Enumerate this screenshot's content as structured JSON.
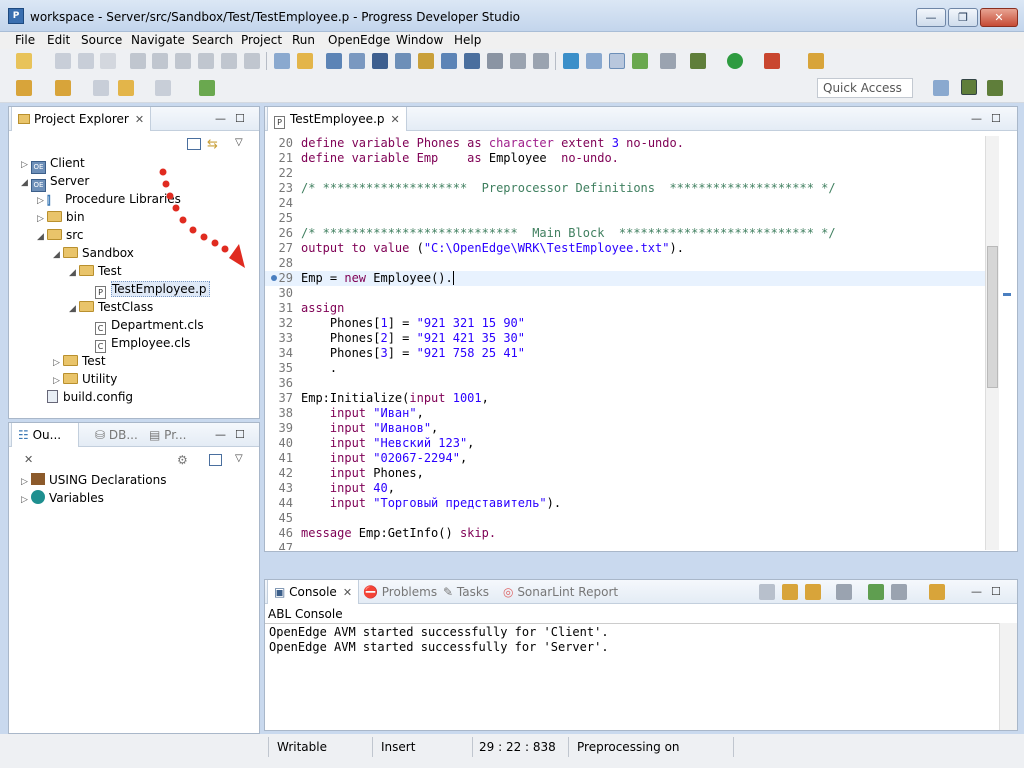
{
  "window": {
    "title": "workspace - Server/src/Sandbox/Test/TestEmployee.p - Progress Developer Studio",
    "min": "—",
    "max": "❐",
    "close": "✕"
  },
  "menu": [
    "File",
    "Edit",
    "Source",
    "Navigate",
    "Search",
    "Project",
    "Run",
    "OpenEdge",
    "Window",
    "Help"
  ],
  "quick_access": "Quick Access",
  "project_explorer": {
    "tab_label": "Project Explorer",
    "items": [
      {
        "label": "Client",
        "type": "project",
        "twisty": "▷"
      },
      {
        "label": "Server",
        "type": "project",
        "twisty": "◢"
      },
      {
        "label": "Procedure Libraries",
        "type": "lib",
        "twisty": "▷"
      },
      {
        "label": "bin",
        "type": "folder",
        "twisty": "▷"
      },
      {
        "label": "src",
        "type": "folder",
        "twisty": "◢"
      },
      {
        "label": "Sandbox",
        "type": "folder",
        "twisty": "◢"
      },
      {
        "label": "Test",
        "type": "folder",
        "twisty": "◢"
      },
      {
        "label": "TestEmployee.p",
        "type": "file-p",
        "twisty": ""
      },
      {
        "label": "TestClass",
        "type": "folder",
        "twisty": "◢"
      },
      {
        "label": "Department.cls",
        "type": "file-c",
        "twisty": ""
      },
      {
        "label": "Employee.cls",
        "type": "file-c",
        "twisty": ""
      },
      {
        "label": "Test",
        "type": "folder",
        "twisty": "▷"
      },
      {
        "label": "Utility",
        "type": "folder",
        "twisty": "▷"
      },
      {
        "label": "build.config",
        "type": "config",
        "twisty": ""
      }
    ]
  },
  "outline": {
    "tabs": [
      "Ou...",
      "DB...",
      "Pr..."
    ],
    "items": [
      {
        "label": "USING Declarations"
      },
      {
        "label": "Variables"
      }
    ]
  },
  "editor": {
    "tab_label": "TestEmployee.p",
    "lines": [
      {
        "n": "20",
        "code": [
          {
            "t": "define variable Phones ",
            "c": "kw"
          },
          {
            "t": "as ",
            "c": "kw"
          },
          {
            "t": "character ",
            "c": "kwb"
          },
          {
            "t": "extent ",
            "c": "kw"
          },
          {
            "t": "3 ",
            "c": "num"
          },
          {
            "t": "no-undo.",
            "c": "kw"
          }
        ]
      },
      {
        "n": "21",
        "code": [
          {
            "t": "define variable Emp    ",
            "c": "kw"
          },
          {
            "t": "as ",
            "c": "kw"
          },
          {
            "t": "Employee  ",
            "c": ""
          },
          {
            "t": "no-undo.",
            "c": "kw"
          }
        ]
      },
      {
        "n": "22",
        "code": []
      },
      {
        "n": "23",
        "code": [
          {
            "t": "/* ********************  Preprocessor Definitions  ******************** */",
            "c": "cmt"
          }
        ]
      },
      {
        "n": "24",
        "code": []
      },
      {
        "n": "25",
        "code": []
      },
      {
        "n": "26",
        "code": [
          {
            "t": "/* ***************************  Main Block  *************************** */",
            "c": "cmt"
          }
        ]
      },
      {
        "n": "27",
        "code": [
          {
            "t": "output to value ",
            "c": "kw"
          },
          {
            "t": "(",
            "c": ""
          },
          {
            "t": "\"C:\\OpenEdge\\WRK\\TestEmployee.txt\"",
            "c": "str"
          },
          {
            "t": ").",
            "c": ""
          }
        ]
      },
      {
        "n": "28",
        "code": []
      },
      {
        "n": "29",
        "code": [
          {
            "t": "Emp = ",
            "c": ""
          },
          {
            "t": "new ",
            "c": "kw"
          },
          {
            "t": "Employee().",
            "c": ""
          }
        ],
        "current": true
      },
      {
        "n": "30",
        "code": []
      },
      {
        "n": "31",
        "code": [
          {
            "t": "assign",
            "c": "kw"
          }
        ]
      },
      {
        "n": "32",
        "code": [
          {
            "t": "    Phones[",
            "c": ""
          },
          {
            "t": "1",
            "c": "num"
          },
          {
            "t": "] = ",
            "c": ""
          },
          {
            "t": "\"921 321 15 90\"",
            "c": "str"
          }
        ]
      },
      {
        "n": "33",
        "code": [
          {
            "t": "    Phones[",
            "c": ""
          },
          {
            "t": "2",
            "c": "num"
          },
          {
            "t": "] = ",
            "c": ""
          },
          {
            "t": "\"921 421 35 30\"",
            "c": "str"
          }
        ]
      },
      {
        "n": "34",
        "code": [
          {
            "t": "    Phones[",
            "c": ""
          },
          {
            "t": "3",
            "c": "num"
          },
          {
            "t": "] = ",
            "c": ""
          },
          {
            "t": "\"921 758 25 41\"",
            "c": "str"
          }
        ]
      },
      {
        "n": "35",
        "code": [
          {
            "t": "    .",
            "c": ""
          }
        ]
      },
      {
        "n": "36",
        "code": []
      },
      {
        "n": "37",
        "code": [
          {
            "t": "Emp:Initialize(",
            "c": ""
          },
          {
            "t": "input ",
            "c": "kw"
          },
          {
            "t": "1001",
            "c": "num"
          },
          {
            "t": ",",
            "c": ""
          }
        ]
      },
      {
        "n": "38",
        "code": [
          {
            "t": "    input ",
            "c": "kw"
          },
          {
            "t": "\"Иван\"",
            "c": "str"
          },
          {
            "t": ",",
            "c": ""
          }
        ]
      },
      {
        "n": "39",
        "code": [
          {
            "t": "    input ",
            "c": "kw"
          },
          {
            "t": "\"Иванов\"",
            "c": "str"
          },
          {
            "t": ",",
            "c": ""
          }
        ]
      },
      {
        "n": "40",
        "code": [
          {
            "t": "    input ",
            "c": "kw"
          },
          {
            "t": "\"Невский 123\"",
            "c": "str"
          },
          {
            "t": ",",
            "c": ""
          }
        ]
      },
      {
        "n": "41",
        "code": [
          {
            "t": "    input ",
            "c": "kw"
          },
          {
            "t": "\"02067-2294\"",
            "c": "str"
          },
          {
            "t": ",",
            "c": ""
          }
        ]
      },
      {
        "n": "42",
        "code": [
          {
            "t": "    input ",
            "c": "kw"
          },
          {
            "t": "Phones,",
            "c": ""
          }
        ]
      },
      {
        "n": "43",
        "code": [
          {
            "t": "    input ",
            "c": "kw"
          },
          {
            "t": "40",
            "c": "num"
          },
          {
            "t": ",",
            "c": ""
          }
        ]
      },
      {
        "n": "44",
        "code": [
          {
            "t": "    input ",
            "c": "kw"
          },
          {
            "t": "\"Торговый представитель\"",
            "c": "str"
          },
          {
            "t": ").",
            "c": ""
          }
        ]
      },
      {
        "n": "45",
        "code": []
      },
      {
        "n": "46",
        "code": [
          {
            "t": "message ",
            "c": "kw"
          },
          {
            "t": "Emp:GetInfo() ",
            "c": ""
          },
          {
            "t": "skip.",
            "c": "kw"
          }
        ]
      },
      {
        "n": "47",
        "code": []
      }
    ]
  },
  "console": {
    "tabs": [
      "Console",
      "Problems",
      "Tasks",
      "SonarLint Report"
    ],
    "header": "ABL Console",
    "lines": [
      "OpenEdge AVM started successfully for 'Client'.",
      "OpenEdge AVM started successfully for 'Server'."
    ]
  },
  "status": {
    "writable": "Writable",
    "mode": "Insert",
    "position": "29 : 22 : 838",
    "preprocessing": "Preprocessing on"
  }
}
